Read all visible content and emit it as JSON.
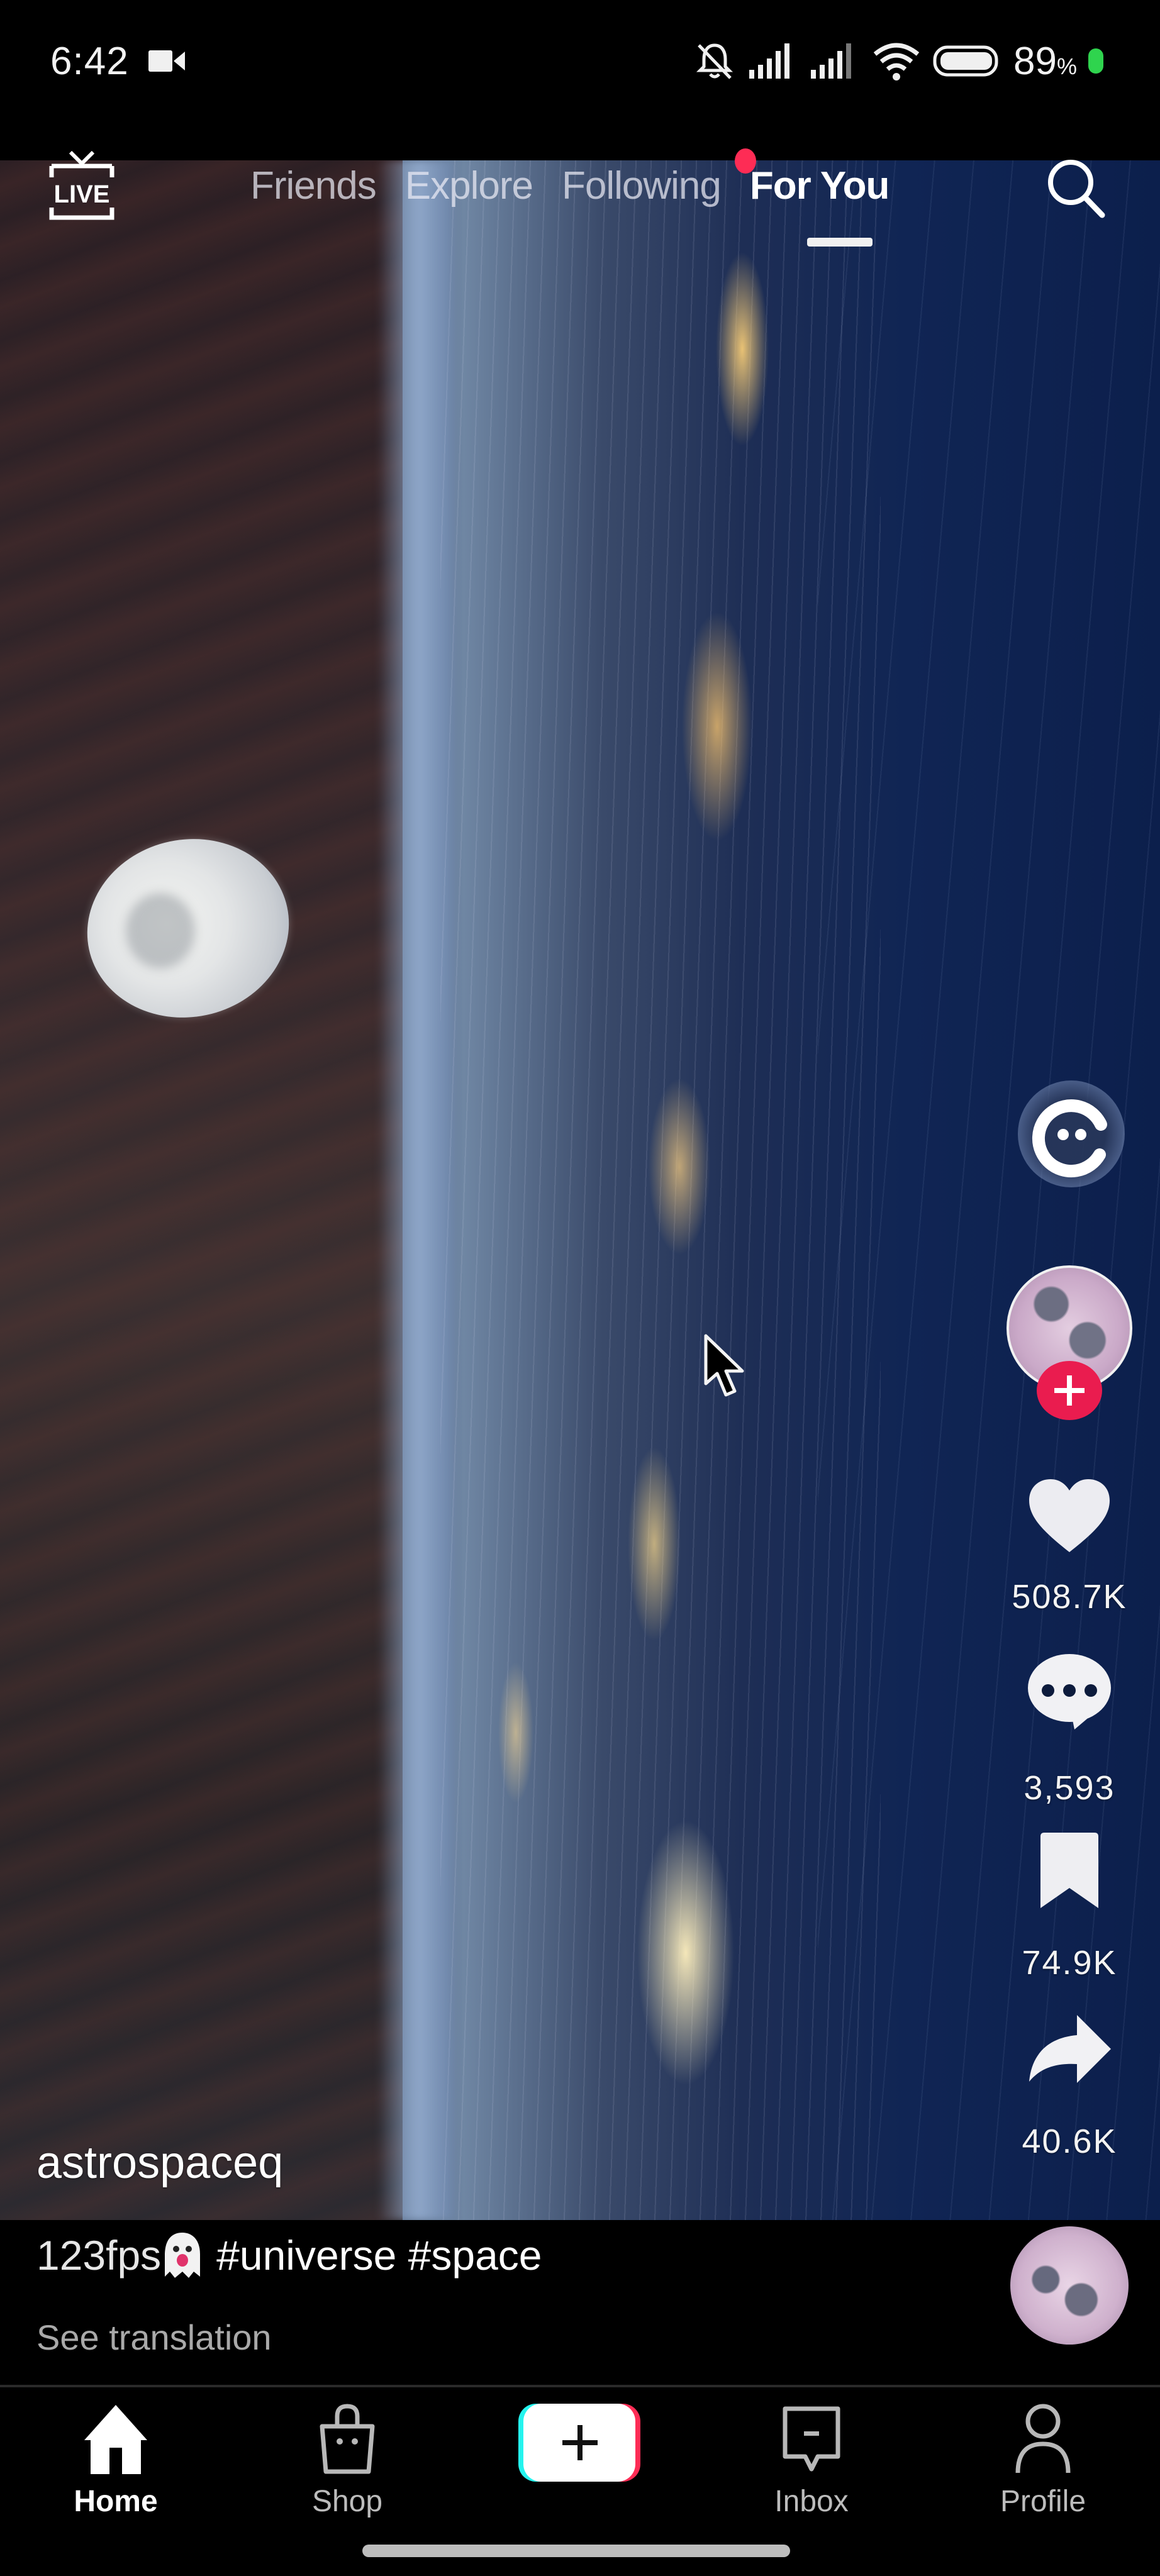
{
  "status_bar": {
    "time": "6:42",
    "battery_percent": "89",
    "battery_suffix": "%",
    "icons": [
      "video-camera-icon",
      "mute-bell-icon",
      "signal-icon",
      "signal-icon-2",
      "wifi-icon",
      "battery-icon",
      "charging-dot"
    ],
    "charging_color": "#2fd44e"
  },
  "top_nav": {
    "live_label": "LIVE",
    "tabs": [
      {
        "label": "Friends",
        "active": false
      },
      {
        "label": "Explore",
        "active": false
      },
      {
        "label": "Following",
        "active": false,
        "has_notification_dot": true
      },
      {
        "label": "For You",
        "active": true
      }
    ],
    "search_icon": "search-icon",
    "notification_dot_color": "#fe2c55"
  },
  "video": {
    "description": "Earth at night from orbit with the moon",
    "cursor_visible": true
  },
  "actions": {
    "ai_assistant_icon": "ai-chat-icon",
    "author_avatar": "moon-avatar",
    "follow_icon": "plus-icon",
    "like_count": "508.7K",
    "comment_count": "3,593",
    "bookmark_count": "74.9K",
    "share_count": "40.6K"
  },
  "post": {
    "author": "astrospaceq",
    "caption_prefix": "123fps",
    "caption_emoji": "ghost-emoji",
    "caption_tags": "#universe #space",
    "see_translation": "See translation"
  },
  "bottom_nav": {
    "items": [
      {
        "label": "Home",
        "icon": "home-icon",
        "active": true
      },
      {
        "label": "Shop",
        "icon": "shopping-bag-icon",
        "active": false
      },
      {
        "label": "",
        "icon": "create-plus-icon",
        "active": false
      },
      {
        "label": "Inbox",
        "icon": "inbox-icon",
        "active": false
      },
      {
        "label": "Profile",
        "icon": "profile-icon",
        "active": false
      }
    ],
    "accent_cyan": "#25f4ee",
    "accent_red": "#fe2c55"
  }
}
